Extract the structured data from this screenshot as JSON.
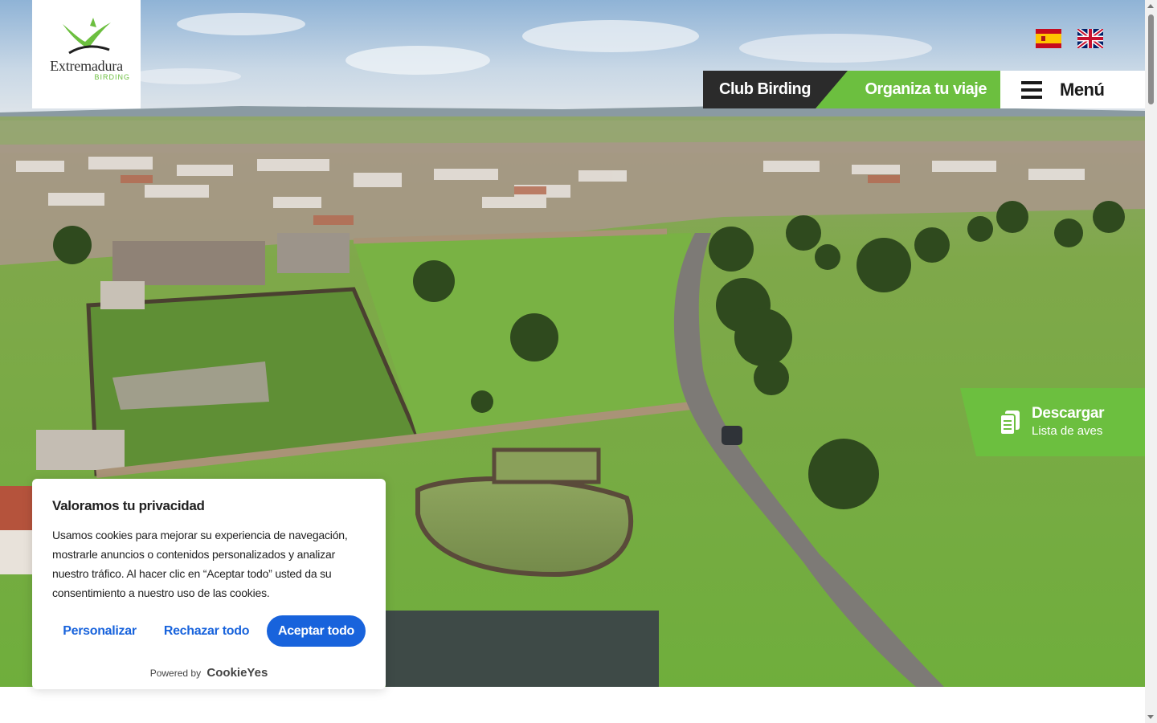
{
  "logo": {
    "name": "Extremadura",
    "sub": "BIRDING"
  },
  "languages": [
    {
      "code": "es",
      "icon": "spain-flag-icon"
    },
    {
      "code": "en",
      "icon": "uk-flag-icon"
    }
  ],
  "nav": {
    "club_label": "Club Birding",
    "organiza_label": "Organiza tu viaje",
    "menu_label": "Menú"
  },
  "download": {
    "title": "Descargar",
    "subtitle": "Lista de aves",
    "icon": "document-icon"
  },
  "cookie_banner": {
    "title": "Valoramos tu privacidad",
    "body": "Usamos cookies para mejorar su experiencia de navegación, mostrarle anuncios o contenidos personalizados y analizar nuestro tráfico. Al hacer clic en “Aceptar todo” usted da su consentimiento a nuestro uso de las cookies.",
    "customize_label": "Personalizar",
    "reject_label": "Rechazar todo",
    "accept_label": "Aceptar todo",
    "powered_by": "Powered by",
    "powered_brand": "CookieYes"
  },
  "colors": {
    "brand_green": "#6cbf3f",
    "dark": "#2b2b2b",
    "cookie_blue": "#1863dc"
  }
}
